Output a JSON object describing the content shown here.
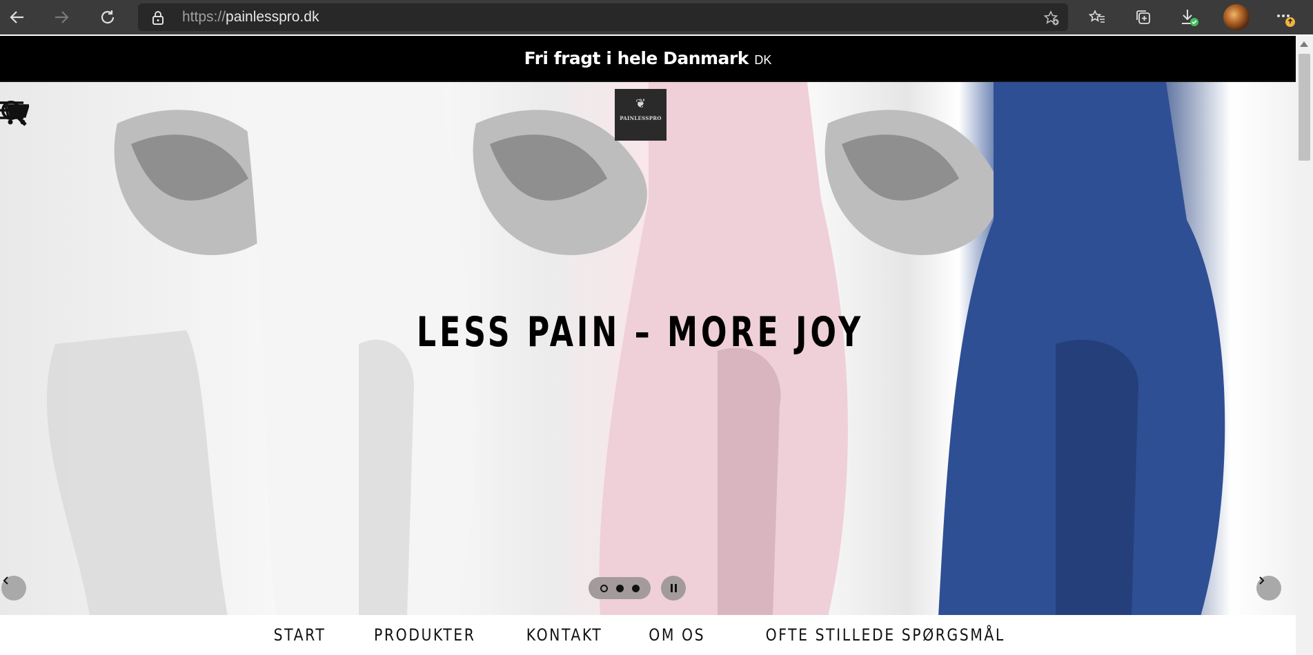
{
  "browser": {
    "url_scheme": "https://",
    "url_host": "painlesspro.dk"
  },
  "announcement": {
    "main": "Fri fragt i hele Danmark",
    "sub": "DK"
  },
  "header": {
    "logo_name": "PAINLESSPRO"
  },
  "hero": {
    "title": "LESS PAIN – MORE JOY",
    "slides_count": 3,
    "active_slide": 1
  },
  "nav": {
    "items": [
      "START",
      "PRODUKTER",
      "KONTAKT",
      "OM OS",
      "OFTE STILLEDE SPØRGSMÅL"
    ]
  },
  "colors": {
    "announcement_bg": "#000000",
    "accent_blue": "#2f4f94",
    "accent_pink": "#f0d2da"
  }
}
